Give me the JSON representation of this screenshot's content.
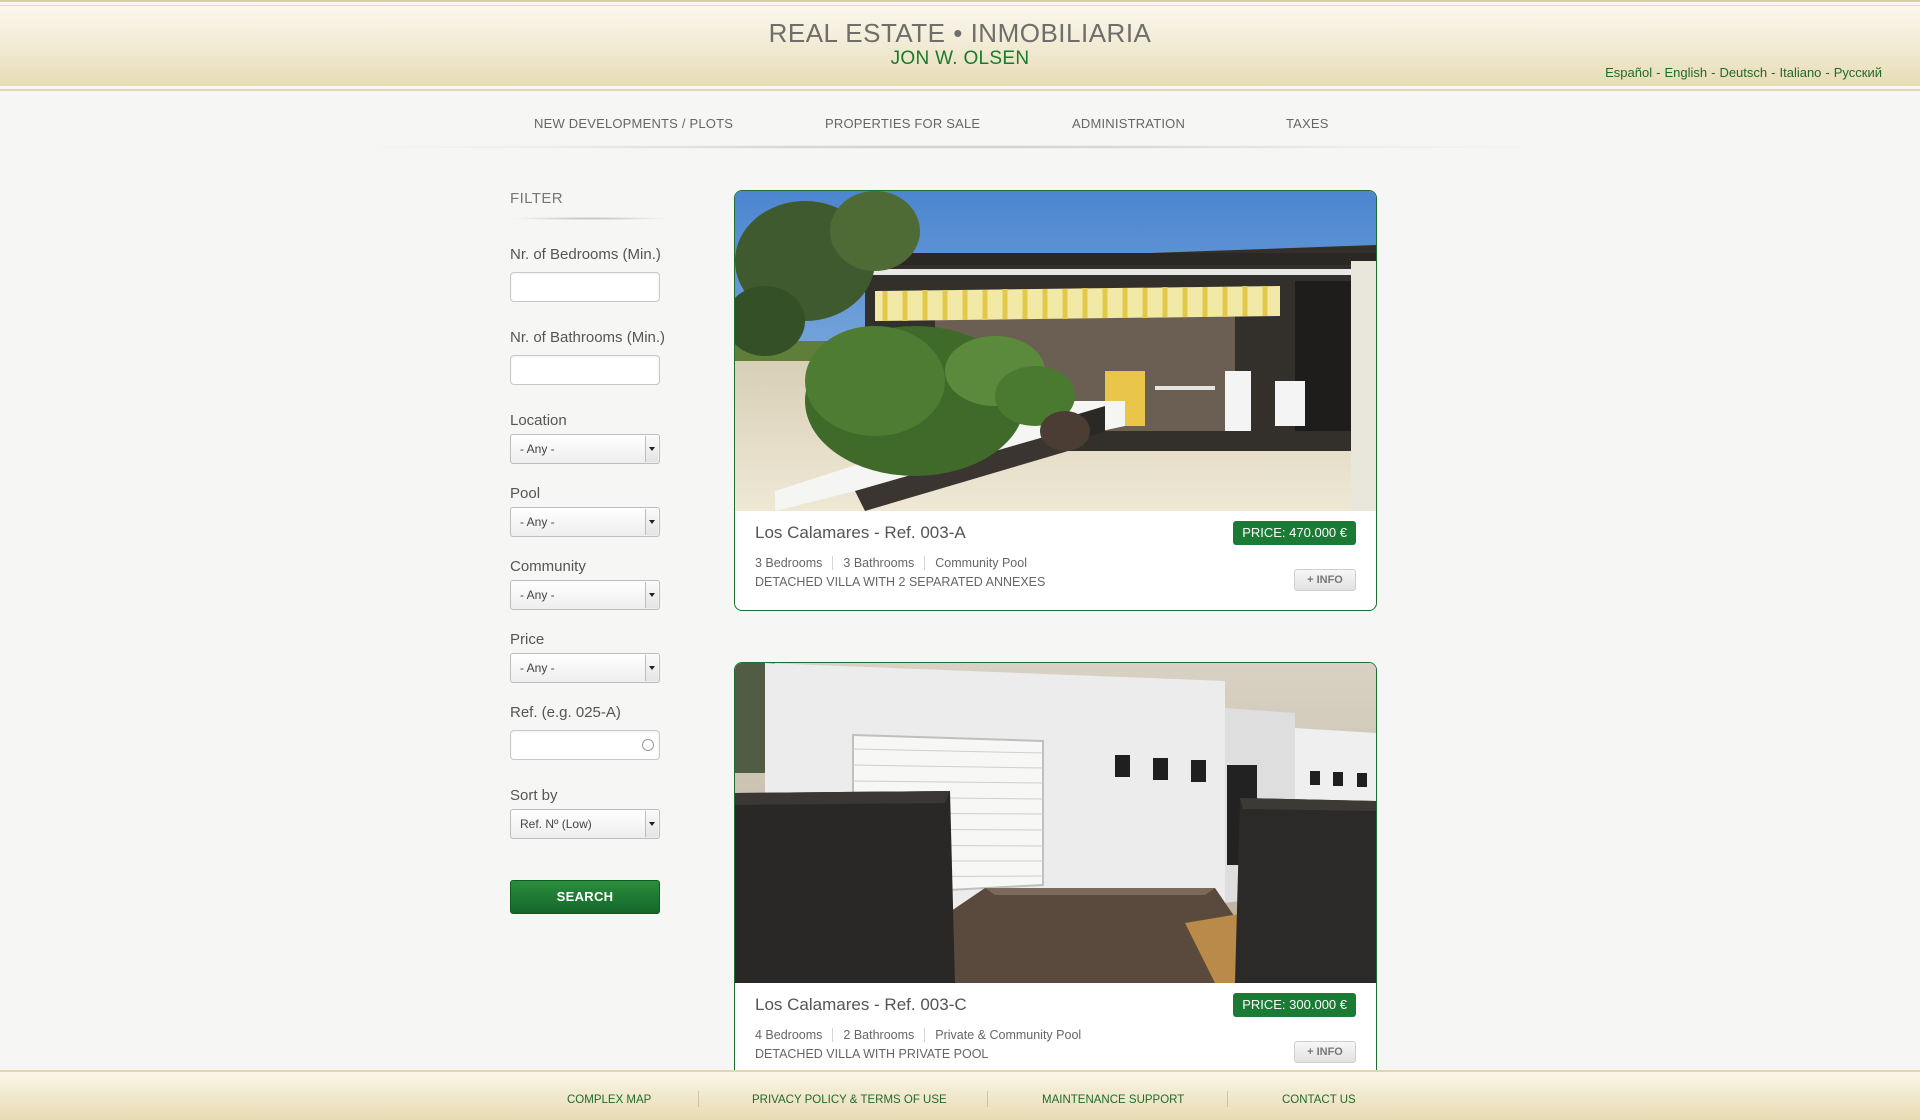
{
  "header": {
    "title": "REAL ESTATE • INMOBILIARIA",
    "subtitle": "JON W. OLSEN",
    "languages": [
      "Español",
      "English",
      "Deutsch",
      "Italiano",
      "Русский"
    ],
    "separator": "-"
  },
  "nav": {
    "items": [
      {
        "label": "NEW DEVELOPMENTS / PLOTS"
      },
      {
        "label": "PROPERTIES FOR SALE"
      },
      {
        "label": "ADMINISTRATION"
      },
      {
        "label": "TAXES"
      }
    ]
  },
  "filter": {
    "title": "FILTER",
    "bedrooms": {
      "label": "Nr. of Bedrooms (Min.)",
      "value": ""
    },
    "bathrooms": {
      "label": "Nr. of Bathrooms (Min.)",
      "value": ""
    },
    "location": {
      "label": "Location",
      "value": "- Any -"
    },
    "pool": {
      "label": "Pool",
      "value": "- Any -"
    },
    "community": {
      "label": "Community",
      "value": "- Any -"
    },
    "price": {
      "label": "Price",
      "value": "- Any -"
    },
    "ref": {
      "label": "Ref. (e.g. 025-A)",
      "value": ""
    },
    "sort": {
      "label": "Sort by",
      "value": "Ref. Nº (Low)"
    },
    "search_label": "SEARCH"
  },
  "properties": [
    {
      "title": "Los Calamares - Ref. 003-A",
      "price": "PRICE:  470.000 €",
      "features": [
        "3 Bedrooms",
        "3 Bathrooms",
        "Community Pool"
      ],
      "description": "DETACHED VILLA WITH 2 SEPARATED ANNEXES",
      "info_label": "+ INFO"
    },
    {
      "title": "Los Calamares - Ref. 003-C",
      "price": "PRICE:  300.000 €",
      "features": [
        "4 Bedrooms",
        "2 Bathrooms",
        "Private & Community Pool"
      ],
      "description": "DETACHED VILLA WITH PRIVATE POOL",
      "info_label": "+ INFO"
    }
  ],
  "footer": {
    "links": [
      {
        "label": "COMPLEX MAP"
      },
      {
        "label": "PRIVACY POLICY & TERMS OF USE"
      },
      {
        "label": "MAINTENANCE SUPPORT"
      },
      {
        "label": "CONTACT US"
      }
    ]
  }
}
